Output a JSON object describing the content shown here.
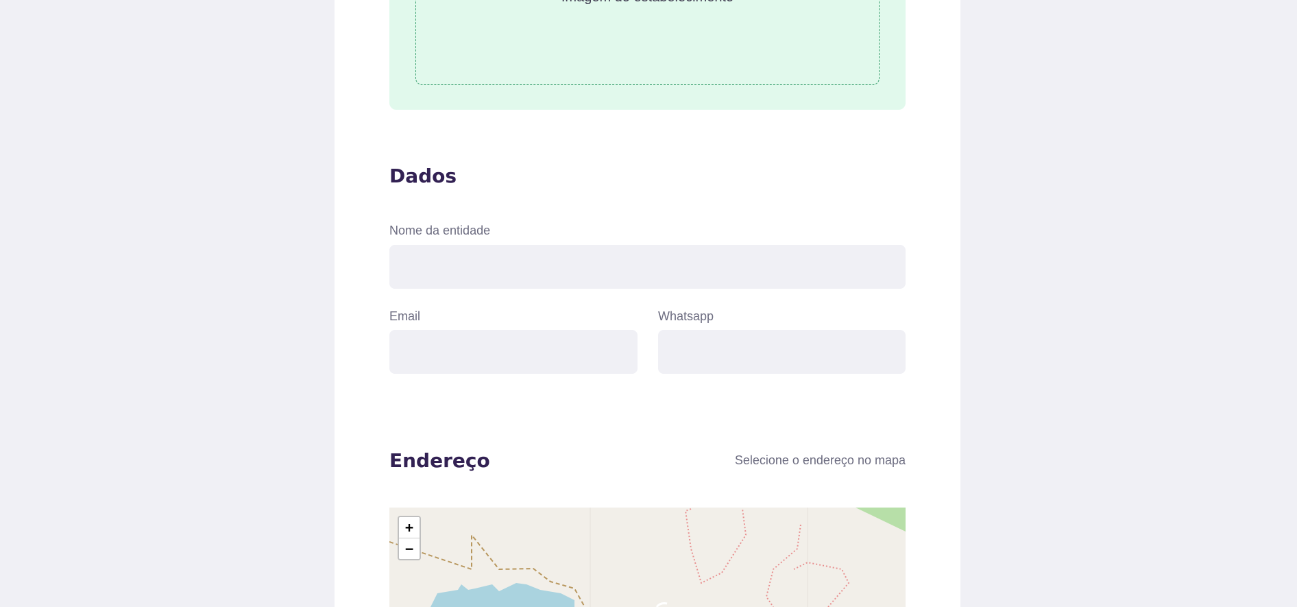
{
  "upload": {
    "label": "Imagem do estabelecimento"
  },
  "dados": {
    "title": "Dados",
    "name_label": "Nome da entidade",
    "email_label": "Email",
    "whatsapp_label": "Whatsapp"
  },
  "endereco": {
    "title": "Endereço",
    "hint": "Selecione o endereço no mapa"
  },
  "map": {
    "zoom_in": "+",
    "zoom_out": "−"
  },
  "colors": {
    "background": "#f0f0f5",
    "title": "#322153",
    "accent_green": "#34cb79",
    "upload_bg": "#e1f9ec",
    "label": "#6c6c80"
  }
}
